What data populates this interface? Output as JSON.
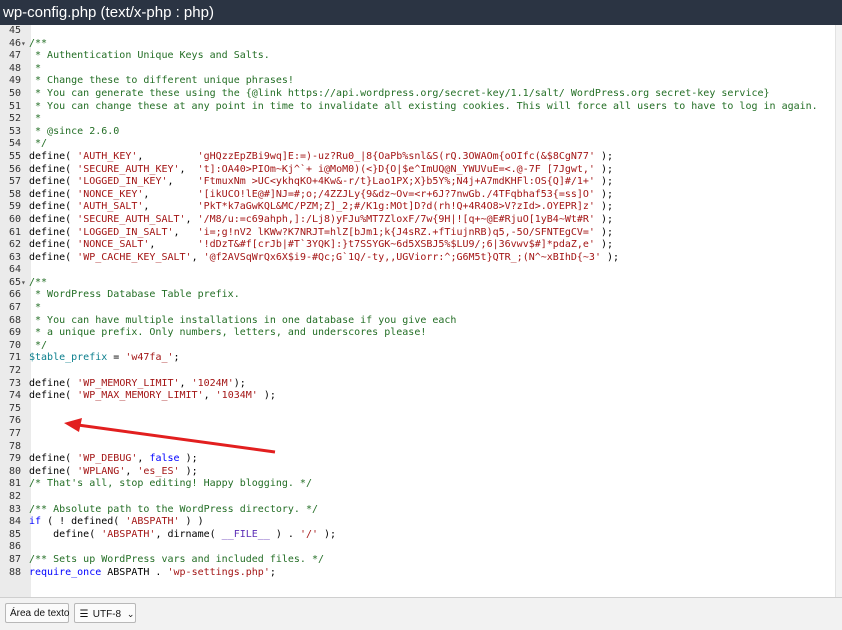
{
  "window": {
    "title": "wp-config.php (text/x-php : php)"
  },
  "code_lines": [
    {
      "n": "45",
      "fold": "",
      "html": ""
    },
    {
      "n": "46",
      "fold": "▾",
      "html": "<span class=\"c\">/**</span>"
    },
    {
      "n": "47",
      "fold": "",
      "html": "<span class=\"c\"> * Authentication Unique Keys and Salts.</span>"
    },
    {
      "n": "48",
      "fold": "",
      "html": "<span class=\"c\"> *</span>"
    },
    {
      "n": "49",
      "fold": "",
      "html": "<span class=\"c\"> * Change these to different unique phrases!</span>"
    },
    {
      "n": "50",
      "fold": "",
      "html": "<span class=\"c\"> * You can generate these using the {@link https://api.wordpress.org/secret-key/1.1/salt/ WordPress.org secret-key service}</span>"
    },
    {
      "n": "51",
      "fold": "",
      "html": "<span class=\"c\"> * You can change these at any point in time to invalidate all existing cookies. This will force all users to have to log in again.</span>"
    },
    {
      "n": "52",
      "fold": "",
      "html": "<span class=\"c\"> *</span>"
    },
    {
      "n": "53",
      "fold": "",
      "html": "<span class=\"c\"> * @since 2.6.0</span>"
    },
    {
      "n": "54",
      "fold": "",
      "html": "<span class=\"c\"> */</span>"
    },
    {
      "n": "55",
      "fold": "",
      "html": "define( <span class=\"s\">'AUTH_KEY'</span>,         <span class=\"s\">'gHQzzEpZBi9wq]E:=)-uz?Ru0_|8{OaPb%snl&amp;S(rQ.3OWAOm{oOIfc(&amp;$8CgN77'</span> );"
    },
    {
      "n": "56",
      "fold": "",
      "html": "define( <span class=\"s\">'SECURE_AUTH_KEY'</span>,  <span class=\"s\">'t]:OA40&gt;PIOm~Kj^`+ i@MoM0)(&lt;}D{O|$e^ImUQ@N_YWUVuE=&lt;.@-7F [7Jgwt,'</span> );"
    },
    {
      "n": "57",
      "fold": "",
      "html": "define( <span class=\"s\">'LOGGED_IN_KEY'</span>,    <span class=\"s\">'FtmuxNm &gt;UC&lt;ykhqKO+4Kw&amp;-r/t}Lao1PX;X}b5Y%;N4j+A7mdKHFl:OS{Q]#/1+'</span> );"
    },
    {
      "n": "58",
      "fold": "",
      "html": "define( <span class=\"s\">'NONCE_KEY'</span>,        <span class=\"s\">'[ikUCO!lE@#]NJ=#;o;/4ZZJLy{9&amp;dz~Ov=&lt;r+6J?7nwGb./4TFqbhaf53{=ss]O'</span> );"
    },
    {
      "n": "59",
      "fold": "",
      "html": "define( <span class=\"s\">'AUTH_SALT'</span>,        <span class=\"s\">'PkT*k7aGwKQL&amp;MC/PZM;Z]_2;#/K1g:MOt]D?d(rh!Q+4R4O8&gt;V?zId&gt;.OYEPR]z'</span> );"
    },
    {
      "n": "60",
      "fold": "",
      "html": "define( <span class=\"s\">'SECURE_AUTH_SALT'</span>, <span class=\"s\">'/M8/u:=c69ahph,]:/Lj8)yFJu%MT7ZloxF/7w{9H|![q+~@E#RjuO[1yB4~Wt#R'</span> );"
    },
    {
      "n": "61",
      "fold": "",
      "html": "define( <span class=\"s\">'LOGGED_IN_SALT'</span>,   <span class=\"s\">'i=;g!nV2 lKWw?K7NRJT=hlZ[bJm1;k{J4sRZ.+fTiujnRB)q5,-5O/SFNTEgCV='</span> );"
    },
    {
      "n": "62",
      "fold": "",
      "html": "define( <span class=\"s\">'NONCE_SALT'</span>,       <span class=\"s\">'!dDzT&amp;#f[crJb|#T`3YQK]:}t7SSYGK~6d5XSBJ5%$LU9/;6|36vwv$#]*pdaZ,e'</span> );"
    },
    {
      "n": "63",
      "fold": "",
      "html": "define( <span class=\"s\">'WP_CACHE_KEY_SALT'</span>, <span class=\"s\">'@f2AVSqWrQx6X$i9-#Qc;G`1Q/-ty,,UGViorr:^;G6M5t}QTR_;(N^~xBIhD{~3'</span> );"
    },
    {
      "n": "64",
      "fold": "",
      "html": ""
    },
    {
      "n": "65",
      "fold": "▾",
      "html": "<span class=\"c\">/**</span>"
    },
    {
      "n": "66",
      "fold": "",
      "html": "<span class=\"c\"> * WordPress Database Table prefix.</span>"
    },
    {
      "n": "67",
      "fold": "",
      "html": "<span class=\"c\"> *</span>"
    },
    {
      "n": "68",
      "fold": "",
      "html": "<span class=\"c\"> * You can have multiple installations in one database if you give each</span>"
    },
    {
      "n": "69",
      "fold": "",
      "html": "<span class=\"c\"> * a unique prefix. Only numbers, letters, and underscores please!</span>"
    },
    {
      "n": "70",
      "fold": "",
      "html": "<span class=\"c\"> */</span>"
    },
    {
      "n": "71",
      "fold": "",
      "html": "<span class=\"v\">$table_prefix</span> = <span class=\"s\">'w47fa_'</span>;"
    },
    {
      "n": "72",
      "fold": "",
      "html": ""
    },
    {
      "n": "73",
      "fold": "",
      "html": "define( <span class=\"s\">'WP_MEMORY_LIMIT'</span>, <span class=\"s\">'1024M'</span>);"
    },
    {
      "n": "74",
      "fold": "",
      "html": "define( <span class=\"s\">'WP_MAX_MEMORY_LIMIT'</span>, <span class=\"s\">'1034M'</span> );"
    },
    {
      "n": "75",
      "fold": "",
      "html": ""
    },
    {
      "n": "76",
      "fold": "",
      "html": ""
    },
    {
      "n": "77",
      "fold": "",
      "html": ""
    },
    {
      "n": "78",
      "fold": "",
      "html": ""
    },
    {
      "n": "79",
      "fold": "",
      "html": "define( <span class=\"s\">'WP_DEBUG'</span>, <span class=\"k\">false</span> );"
    },
    {
      "n": "80",
      "fold": "",
      "html": "define( <span class=\"s\">'WPLANG'</span>, <span class=\"s\">'es_ES'</span> );"
    },
    {
      "n": "81",
      "fold": "",
      "html": "<span class=\"c\">/* That's all, stop editing! Happy blogging. */</span>"
    },
    {
      "n": "82",
      "fold": "",
      "html": ""
    },
    {
      "n": "83",
      "fold": "",
      "html": "<span class=\"c\">/** Absolute path to the WordPress directory. */</span>"
    },
    {
      "n": "84",
      "fold": "",
      "html": "<span class=\"k\">if</span> ( ! defined( <span class=\"s\">'ABSPATH'</span> ) )"
    },
    {
      "n": "85",
      "fold": "",
      "html": "    define( <span class=\"s\">'ABSPATH'</span>, dirname( <span class=\"b\">__FILE__</span> ) . <span class=\"s\">'/'</span> );"
    },
    {
      "n": "86",
      "fold": "",
      "html": ""
    },
    {
      "n": "87",
      "fold": "",
      "html": "<span class=\"c\">/** Sets up WordPress vars and included files. */</span>"
    },
    {
      "n": "88",
      "fold": "",
      "html": "<span class=\"k\">require_once</span> ABSPATH . <span class=\"s\">'wp-settings.php'</span>;"
    }
  ],
  "statusbar": {
    "text_area_label": "Área de texto",
    "encoding_label": "UTF-8",
    "encoding_icon": "settings-sliders-icon",
    "dropdown_icon": "chevron-down-icon"
  },
  "annotation": {
    "arrow_color": "#e21f1f"
  }
}
